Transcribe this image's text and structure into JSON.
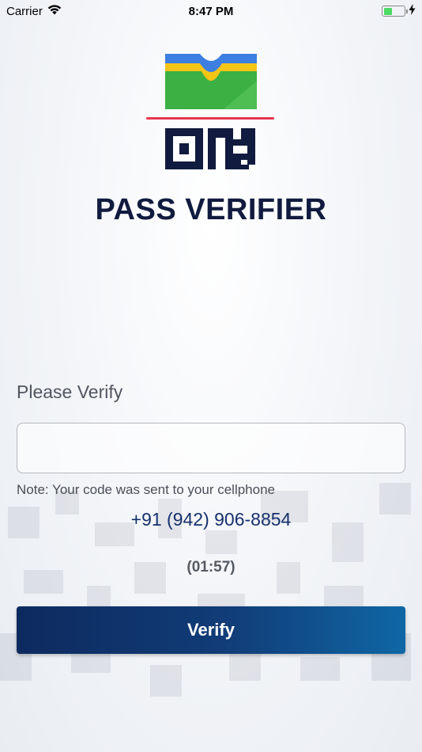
{
  "status_bar": {
    "carrier": "Carrier",
    "time": "8:47 PM",
    "battery_level": 0.4
  },
  "app": {
    "title": "PASS VERIFIER"
  },
  "form": {
    "prompt": "Please Verify",
    "code_value": "",
    "code_placeholder": "",
    "note": "Note: Your code was sent to your cellphone",
    "phone": "+91 (942) 906-8854",
    "timer": "(01:57)",
    "verify_label": "Verify"
  },
  "colors": {
    "title": "#111b3f",
    "button_start": "#0d2a5f",
    "button_end": "#0f67a5",
    "phone_text": "#16306d",
    "logo_blue": "#3d7fe0",
    "logo_yellow": "#f5c518",
    "logo_green": "#3cb043",
    "logo_red_line": "#e8344e"
  }
}
